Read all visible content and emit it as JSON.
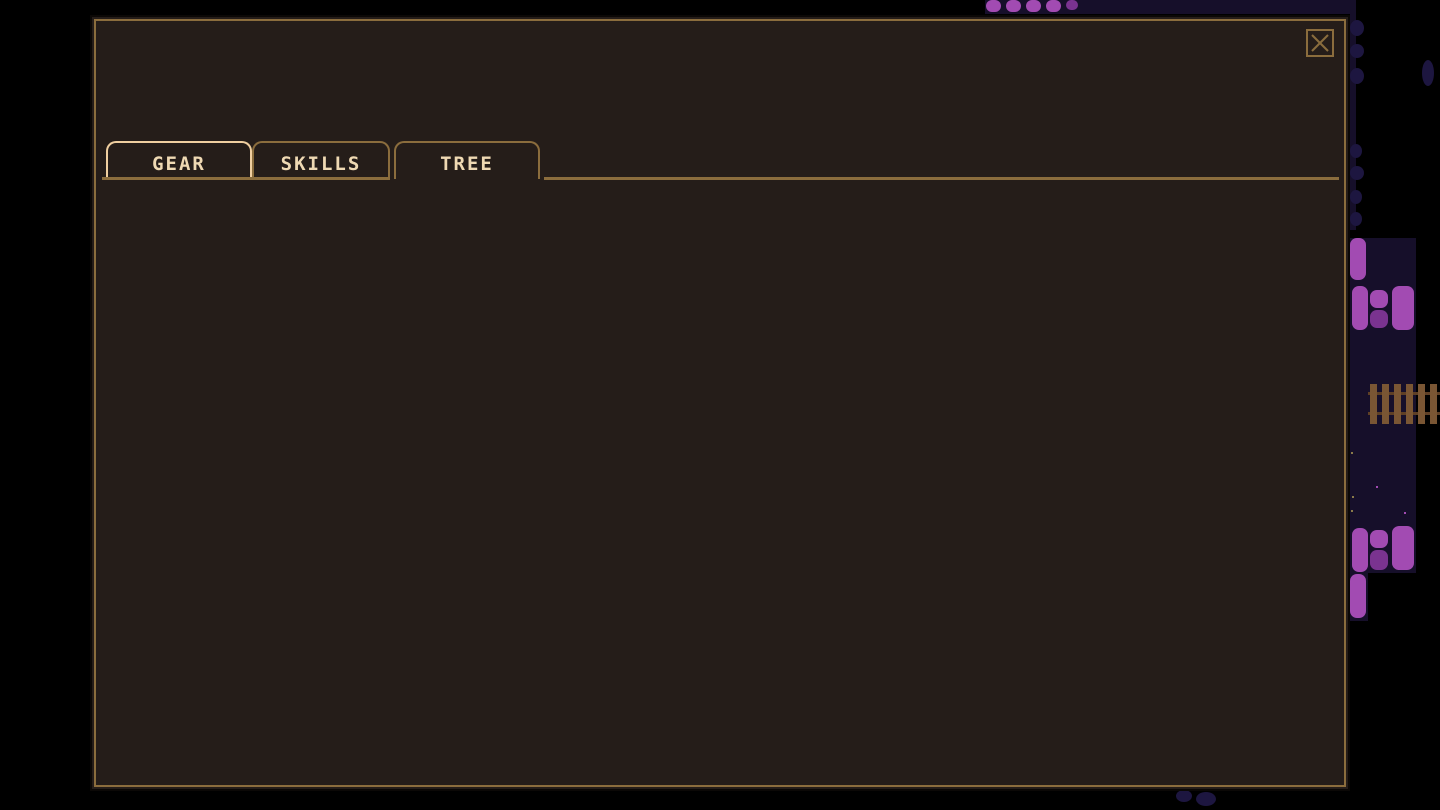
{
  "panel": {
    "tabs": [
      {
        "label": "GEAR"
      },
      {
        "label": "SKILLS"
      },
      {
        "label": "TREE"
      }
    ],
    "active_tab": "TREE",
    "close_icon": "close-icon"
  },
  "colors": {
    "panel_background": "#251d19",
    "panel_border": "#8b6d3d",
    "tab_text": "#efd9b3",
    "page_background": "#000000",
    "crystal": "#a24bb2",
    "night_ground": "#160f2a"
  }
}
